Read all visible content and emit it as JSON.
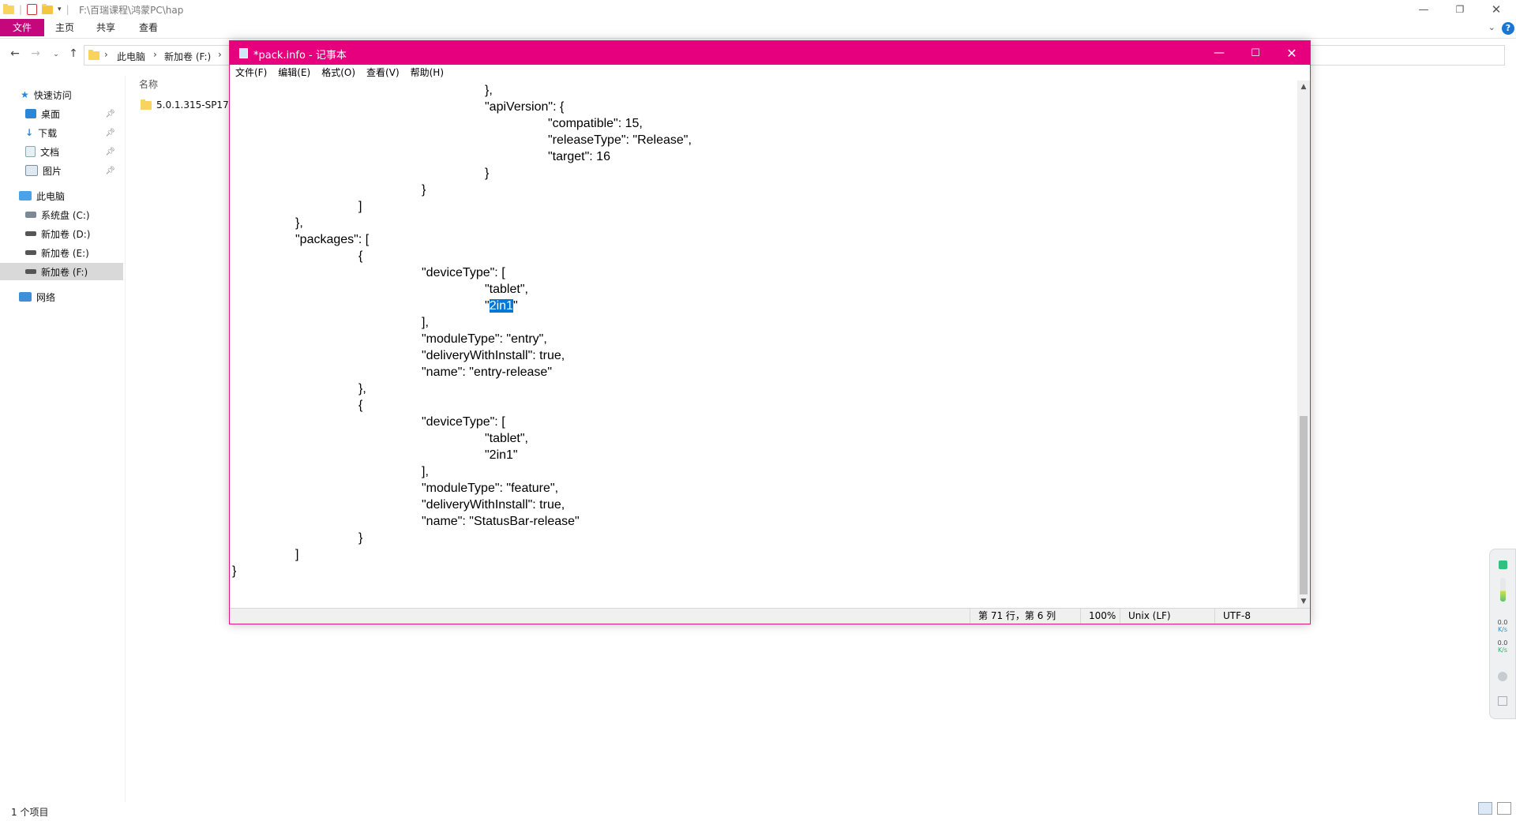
{
  "explorer": {
    "title_path": "F:\\百瑞课程\\鸿蒙PC\\hap",
    "ribbon_tabs": [
      "文件",
      "主页",
      "共享",
      "查看"
    ],
    "breadcrumbs": [
      "此电脑",
      "新加卷 (F:)"
    ],
    "nav": {
      "quick_access": "快速访问",
      "quick_items": [
        "桌面",
        "下载",
        "文档",
        "图片"
      ],
      "this_pc": "此电脑",
      "drives": [
        "系统盘 (C:)",
        "新加卷 (D:)",
        "新加卷 (E:)",
        "新加卷 (F:)"
      ],
      "network": "网络"
    },
    "column_header": "名称",
    "files": [
      "5.0.1.315-SP17"
    ],
    "status": "1 个项目",
    "help": "?"
  },
  "net_widget": {
    "up": "0.0",
    "up_unit": "K/s",
    "down": "0.0",
    "down_unit": "K/s"
  },
  "notepad": {
    "title": "*pack.info - 记事本",
    "menus": [
      "文件(F)",
      "编辑(E)",
      "格式(O)",
      "查看(V)",
      "帮助(H)"
    ],
    "lines_before": [
      "\t\t\t\t},",
      "\t\t\t\t\"apiVersion\": {",
      "\t\t\t\t\t\"compatible\": 15,",
      "\t\t\t\t\t\"releaseType\": \"Release\",",
      "\t\t\t\t\t\"target\": 16",
      "\t\t\t\t}",
      "\t\t\t}",
      "\t\t]",
      "\t},",
      "\t\"packages\": [",
      "\t\t{",
      "\t\t\t\"deviceType\": [",
      "\t\t\t\t\"tablet\","
    ],
    "selected_line_prefix": "\t\t\t\t\"",
    "selected_text": "2in1",
    "selected_line_suffix": "\"",
    "lines_after": [
      "\t\t\t],",
      "\t\t\t\"moduleType\": \"entry\",",
      "\t\t\t\"deliveryWithInstall\": true,",
      "\t\t\t\"name\": \"entry-release\"",
      "\t\t},",
      "\t\t{",
      "\t\t\t\"deviceType\": [",
      "\t\t\t\t\"tablet\",",
      "\t\t\t\t\"2in1\"",
      "\t\t\t],",
      "\t\t\t\"moduleType\": \"feature\",",
      "\t\t\t\"deliveryWithInstall\": true,",
      "\t\t\t\"name\": \"StatusBar-release\"",
      "\t\t}",
      "\t]",
      "}"
    ],
    "status": {
      "position": "第 71 行，第 6 列",
      "zoom": "100%",
      "line_ending": "Unix (LF)",
      "encoding": "UTF-8"
    }
  }
}
